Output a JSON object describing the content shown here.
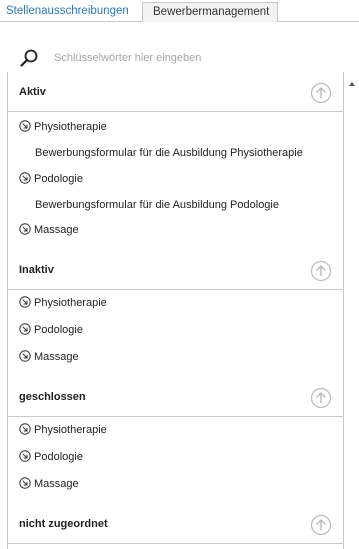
{
  "tabs": {
    "active": "Stellenausschreibungen",
    "inactive": "Bewerbermanagement"
  },
  "search": {
    "placeholder": "Schlüsselwörter hier eingeben"
  },
  "sections": [
    {
      "title": "Aktiv",
      "items": [
        {
          "label": "Physiotherapie",
          "sub": "Bewerbungsformular für die Ausbildung Physiotherapie"
        },
        {
          "label": "Podologie",
          "sub": "Bewerbungsformular für die Ausbildung Podologie"
        },
        {
          "label": "Massage"
        }
      ]
    },
    {
      "title": "Inaktiv",
      "items": [
        {
          "label": "Physiotherapie"
        },
        {
          "label": "Podologie"
        },
        {
          "label": "Massage"
        }
      ]
    },
    {
      "title": "geschlossen",
      "items": [
        {
          "label": "Physiotherapie"
        },
        {
          "label": "Podologie"
        },
        {
          "label": "Massage"
        }
      ]
    },
    {
      "title": "nicht zugeordnet",
      "items": []
    }
  ]
}
